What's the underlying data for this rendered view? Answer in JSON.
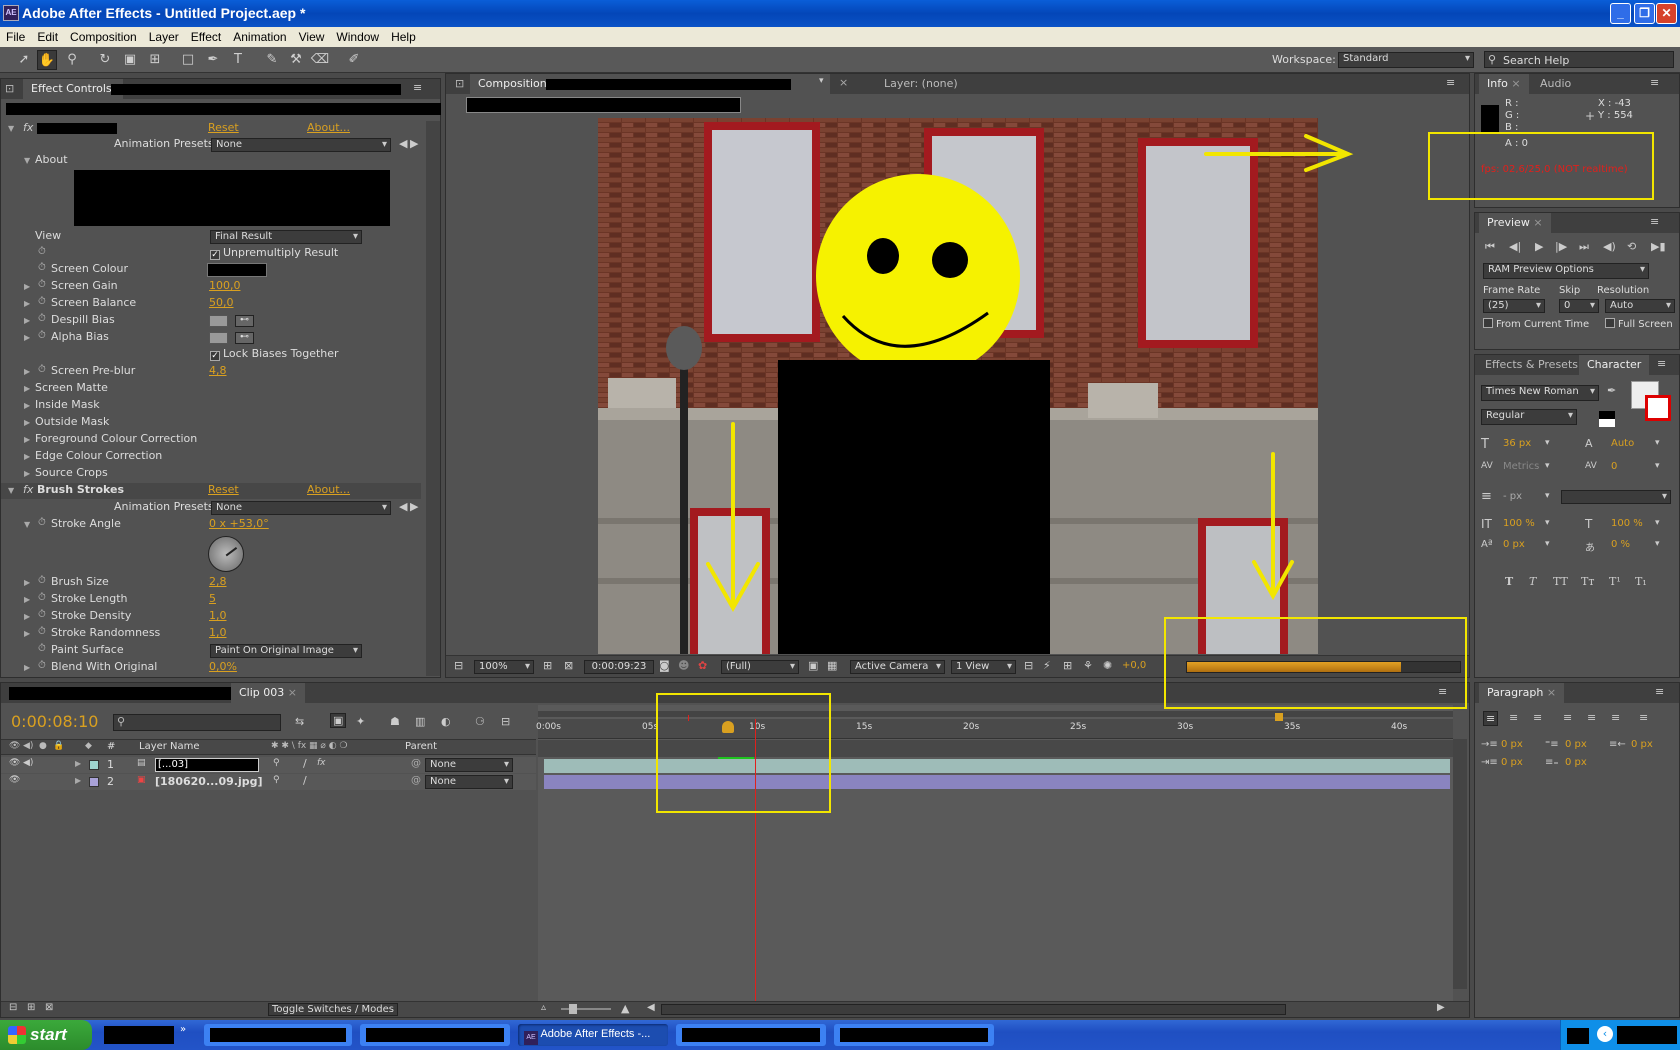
{
  "window": {
    "title": "Adobe After Effects - Untitled Project.aep *",
    "app_icon": "AE"
  },
  "menu": [
    "File",
    "Edit",
    "Composition",
    "Layer",
    "Effect",
    "Animation",
    "View",
    "Window",
    "Help"
  ],
  "toolbar": {
    "workspace_label": "Workspace:",
    "workspace_value": "Standard",
    "search_placeholder": "Search Help"
  },
  "effect_controls": {
    "tab_label": "Effect Controls:",
    "effect1": {
      "reset": "Reset",
      "about": "About...",
      "presets_label": "Animation Presets:",
      "presets_value": "None",
      "about_section": "About",
      "view_label": "View",
      "view_value": "Final Result",
      "unpremultiply": "Unpremultiply Result",
      "screen_colour": "Screen Colour",
      "screen_gain": "Screen Gain",
      "screen_gain_value": "100,0",
      "screen_balance": "Screen Balance",
      "screen_balance_value": "50,0",
      "despill_bias": "Despill Bias",
      "alpha_bias": "Alpha Bias",
      "lock_biases": "Lock Biases Together",
      "screen_preblur": "Screen Pre-blur",
      "screen_preblur_value": "4,8",
      "screen_matte": "Screen Matte",
      "inside_mask": "Inside Mask",
      "outside_mask": "Outside Mask",
      "fg_colour": "Foreground Colour Correction",
      "edge_colour": "Edge Colour Correction",
      "source_crops": "Source Crops"
    },
    "effect2": {
      "name": "Brush Strokes",
      "reset": "Reset",
      "about": "About...",
      "presets_label": "Animation Presets:",
      "presets_value": "None",
      "stroke_angle": "Stroke Angle",
      "stroke_angle_value": "0 x +53,0°",
      "brush_size": "Brush Size",
      "brush_size_value": "2,8",
      "stroke_length": "Stroke Length",
      "stroke_length_value": "5",
      "stroke_density": "Stroke Density",
      "stroke_density_value": "1,0",
      "stroke_randomness": "Stroke Randomness",
      "stroke_randomness_value": "1,0",
      "paint_surface": "Paint Surface",
      "paint_surface_value": "Paint On Original Image",
      "blend": "Blend With Original",
      "blend_value": "0,0%"
    }
  },
  "composition": {
    "tab_label": "Composition:",
    "layer_tab": "Layer: (none)",
    "footer": {
      "zoom": "100%",
      "timecode": "0:00:09:23",
      "resolution": "(Full)",
      "camera": "Active Camera",
      "views": "1 View",
      "exposure": "+0,0"
    }
  },
  "info": {
    "tab_info": "Info",
    "tab_audio": "Audio",
    "r": "R :",
    "g": "G :",
    "b": "B :",
    "a": "A : 0",
    "x": "X : -43",
    "y": "Y : 554",
    "fps": "fps: 02,6/25,0 (NOT realtime)"
  },
  "preview": {
    "tab": "Preview",
    "ram_options": "RAM Preview Options",
    "frame_rate_label": "Frame Rate",
    "frame_rate_value": "(25)",
    "skip_label": "Skip",
    "skip_value": "0",
    "resolution_label": "Resolution",
    "resolution_value": "Auto",
    "from_current": "From Current Time",
    "full_screen": "Full Screen"
  },
  "character": {
    "tab_effects": "Effects & Presets",
    "tab_character": "Character",
    "font": "Times New Roman",
    "style": "Regular",
    "size": "36 px",
    "leading": "Auto",
    "kerning": "Metrics",
    "tracking": "0",
    "stroke_width": "- px",
    "vscale": "100 %",
    "hscale": "100 %",
    "baseline": "0 px",
    "tsume": "0 %",
    "styles": [
      "T",
      "T",
      "TT",
      "Tт",
      "T¹",
      "T₁"
    ]
  },
  "paragraph": {
    "tab": "Paragraph",
    "indent_left": "0 px",
    "indent_first": "0 px",
    "indent_right": "0 px",
    "space_before": "0 px",
    "space_after": "0 px"
  },
  "timeline": {
    "tab_label": "Clip 003",
    "timecode": "0:00:08:10",
    "ruler": [
      "0:00s",
      "05s",
      "10s",
      "15s",
      "20s",
      "25s",
      "30s",
      "35s",
      "40s"
    ],
    "col_layer_name": "Layer Name",
    "col_num": "#",
    "col_parent": "Parent",
    "layers": [
      {
        "num": "1",
        "name": "[...03]",
        "parent": "None"
      },
      {
        "num": "2",
        "name": "[180620...09.jpg]",
        "parent": "None"
      }
    ],
    "toggle": "Toggle Switches / Modes"
  },
  "taskbar": {
    "start": "start",
    "active_task": "Adobe After Effects -..."
  },
  "colors": {
    "accent": "#d9a020",
    "annotation": "#f2e600",
    "fps_red": "#e0201c"
  }
}
